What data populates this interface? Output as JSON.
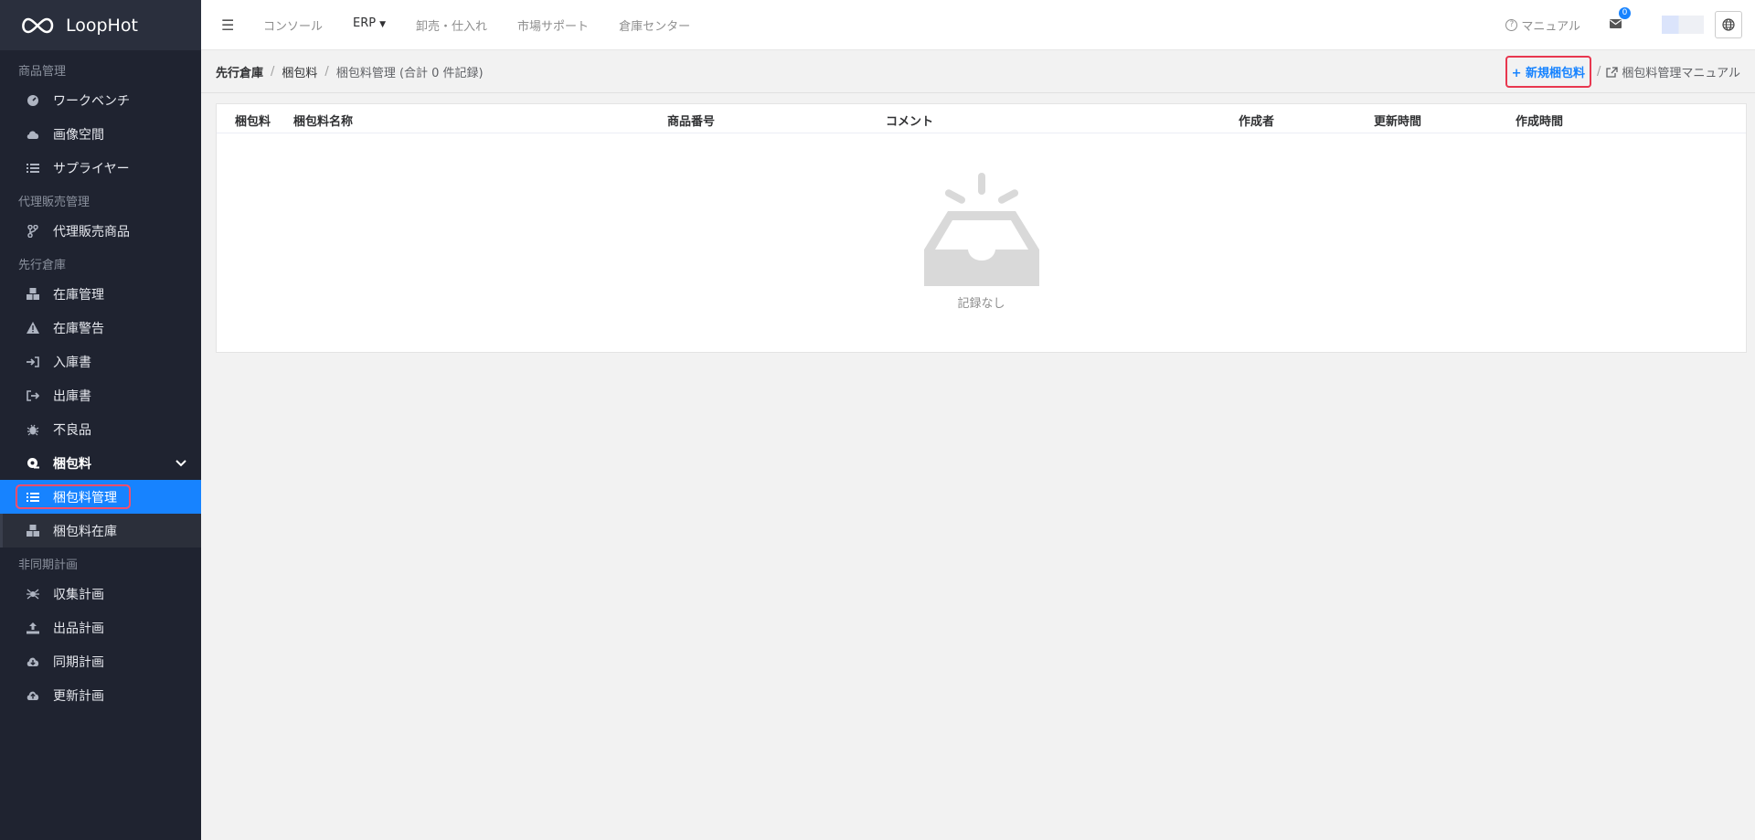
{
  "app": {
    "name": "LoopHot"
  },
  "sidebar": {
    "sections": [
      {
        "title": "商品管理",
        "items": [
          "ワークベンチ",
          "画像空間",
          "サプライヤー"
        ]
      },
      {
        "title": "代理販売管理",
        "items": [
          "代理販売商品"
        ]
      },
      {
        "title": "先行倉庫",
        "items": [
          "在庫管理",
          "在庫警告",
          "入庫書",
          "出庫書",
          "不良品",
          "梱包料",
          "梱包料管理",
          "梱包料在庫"
        ]
      },
      {
        "title": "非同期計画",
        "items": [
          "収集計画",
          "出品計画",
          "同期計画",
          "更新計画"
        ]
      }
    ],
    "active_item": "梱包料管理"
  },
  "topbar": {
    "nav": [
      "コンソール",
      "ERP",
      "卸売・仕入れ",
      "市場サポート",
      "倉庫センター"
    ],
    "manual": "マニュアル",
    "mail_count": "0"
  },
  "breadcrumb": {
    "items": [
      "先行倉庫",
      "梱包料",
      "梱包料管理 (合計 0 件記録)"
    ],
    "new_button": "+ 新規梱包料",
    "manual_link": "梱包料管理マニュアル"
  },
  "table": {
    "columns": [
      "梱包料",
      "梱包料名称",
      "商品番号",
      "コメント",
      "作成者",
      "更新時間",
      "作成時間"
    ],
    "rows": [],
    "empty_text": "記録なし"
  },
  "colors": {
    "accent": "#1783ff",
    "sidebar_bg": "#1f2330",
    "highlight": "#e8374f"
  }
}
